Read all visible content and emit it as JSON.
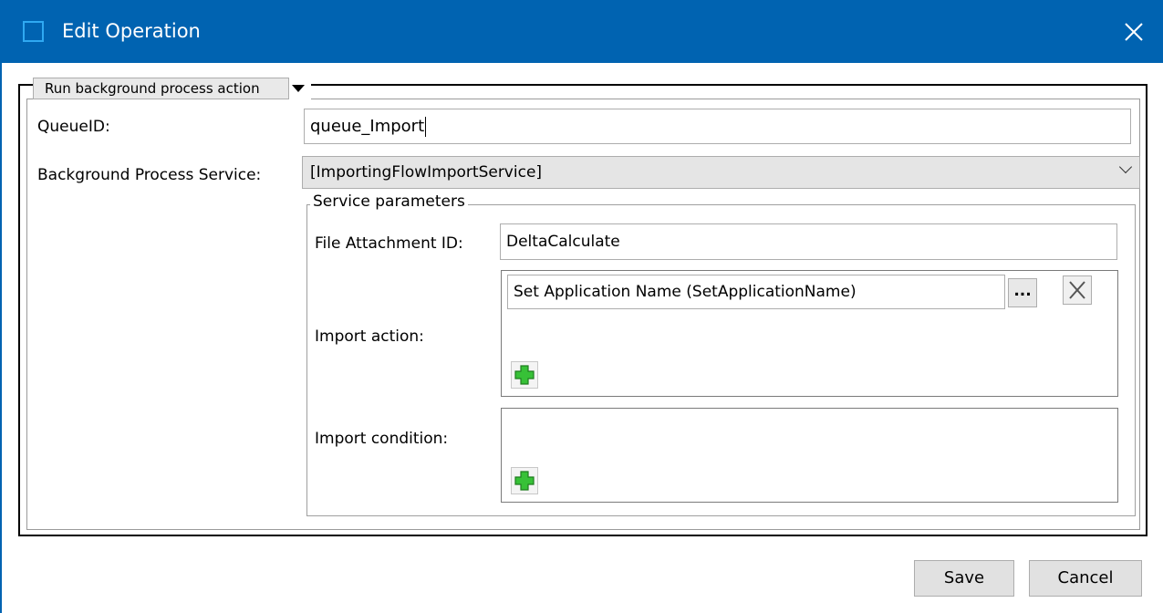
{
  "window": {
    "title": "Edit Operation"
  },
  "action_selector": {
    "selected": "Run background process action"
  },
  "form": {
    "queue_label": "QueueID:",
    "queue_value": "queue_Import",
    "service_label": "Background Process Service:",
    "service_value": "[ImportingFlowImportService]"
  },
  "service_parameters": {
    "caption": "Service parameters",
    "file_attachment_label": "File Attachment ID:",
    "file_attachment_value": "DeltaCalculate",
    "import_action_label": "Import action:",
    "import_action_items": [
      "Set Application Name (SetApplicationName)"
    ],
    "browse_label": "...",
    "import_condition_label": "Import condition:"
  },
  "footer": {
    "save_label": "Save",
    "cancel_label": "Cancel"
  },
  "colors": {
    "titlebar": "#0063b1",
    "plus": "#2db52d"
  },
  "icons": {
    "window": "window-icon",
    "close": "close-icon",
    "remove": "remove-x-icon",
    "add": "add-plus-icon",
    "dropdown": "triangle-down-icon",
    "chevron": "chevron-down-icon"
  }
}
